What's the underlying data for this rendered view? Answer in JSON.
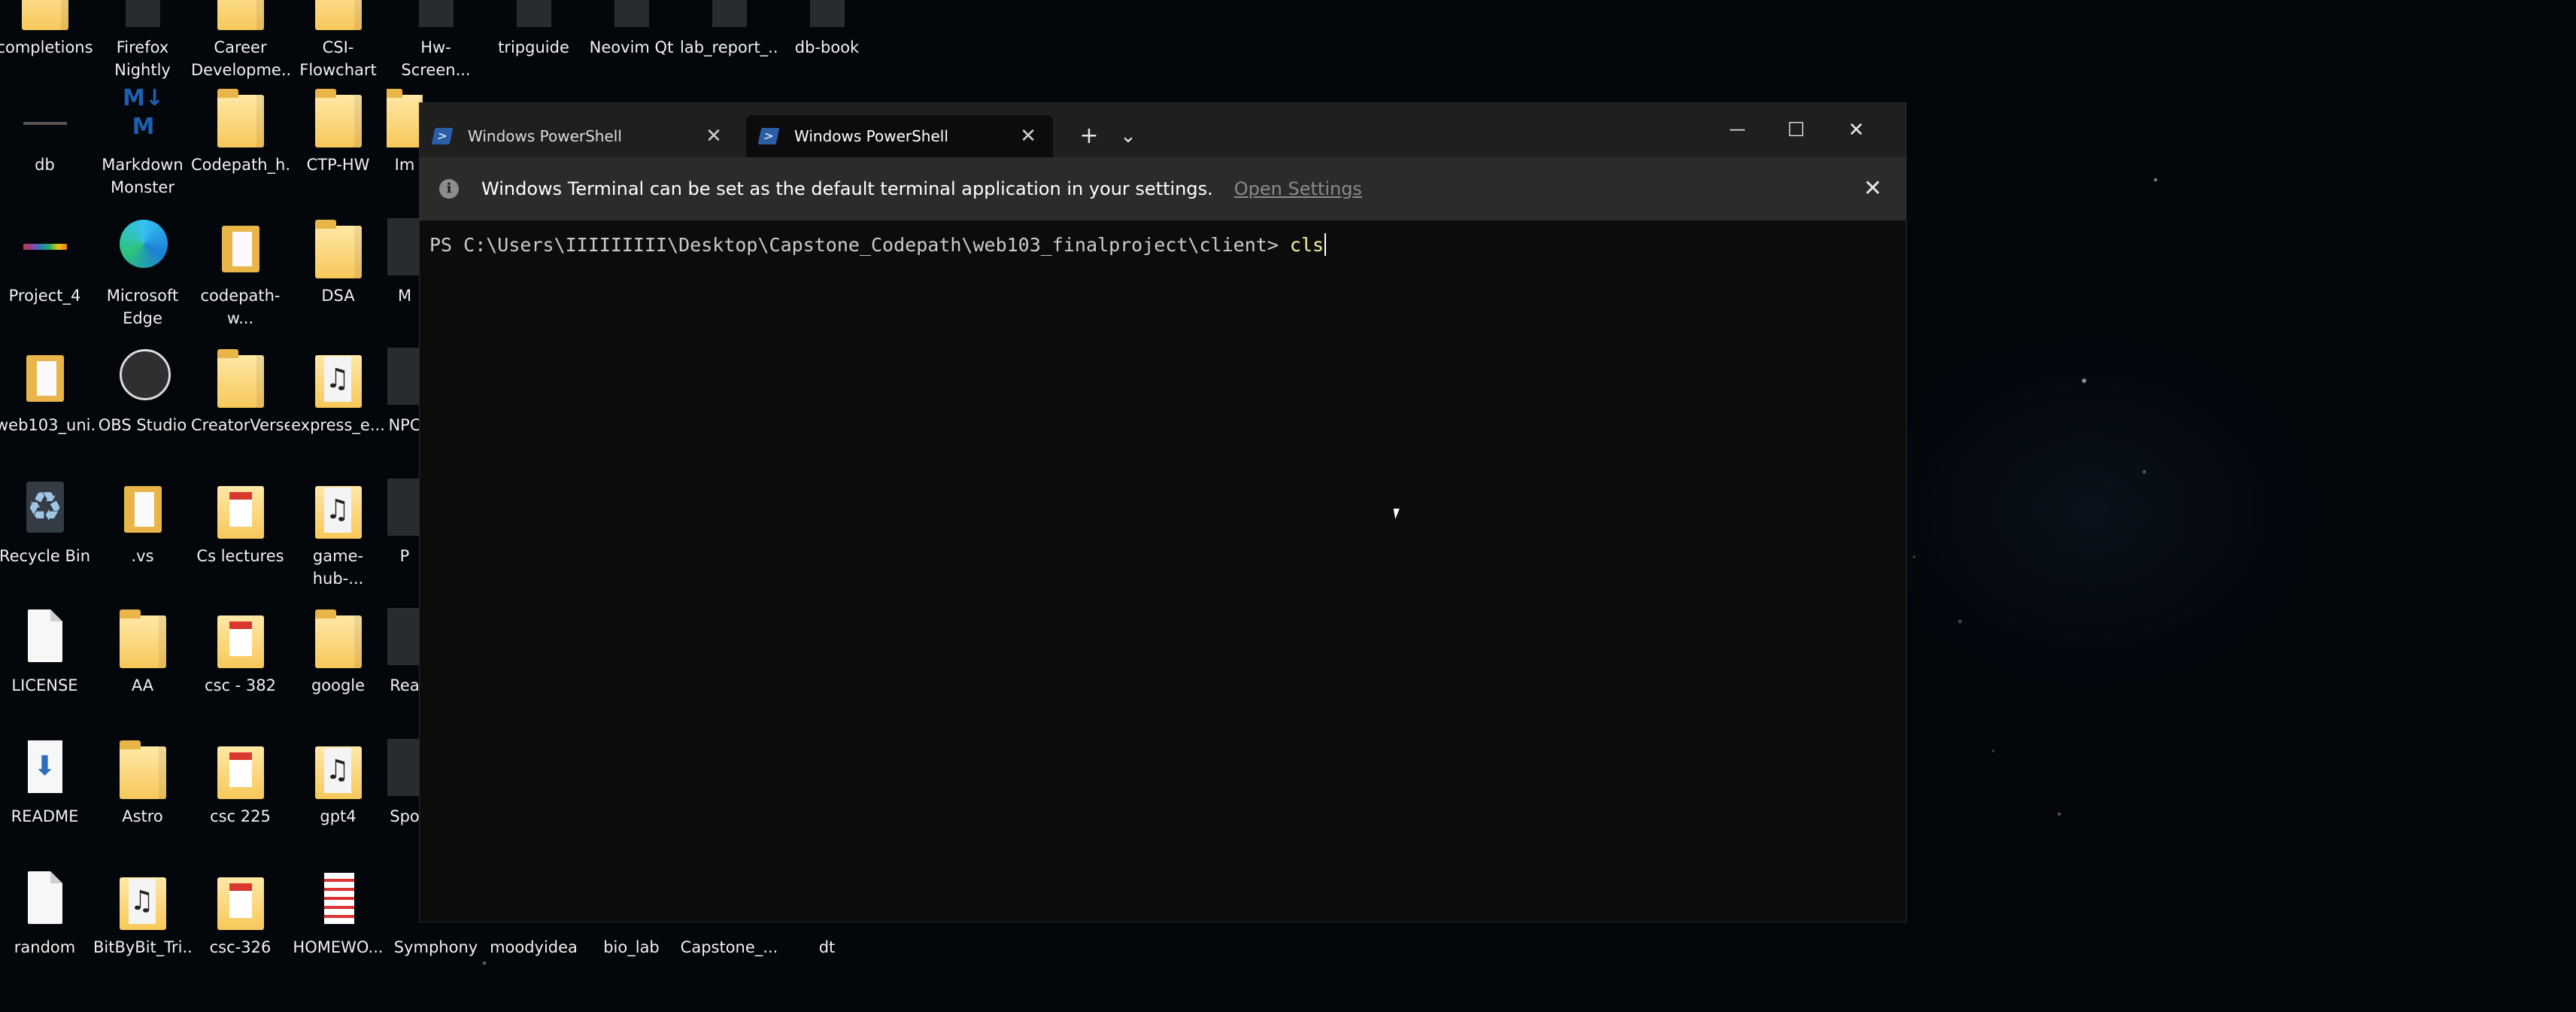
{
  "desktop": {
    "icons": [
      {
        "label": "completions",
        "glyph": "g-folder"
      },
      {
        "label": "Firefox\nNightly",
        "glyph": "g-tiny"
      },
      {
        "label": "Career\nDevelopme...",
        "glyph": "g-folder"
      },
      {
        "label": "CSI-Flowchart",
        "glyph": "g-folder"
      },
      {
        "label": "Hw-Screen...",
        "glyph": "g-tiny"
      },
      {
        "label": "tripguide",
        "glyph": "g-tiny"
      },
      {
        "label": "Neovim Qt",
        "glyph": "g-tiny"
      },
      {
        "label": "lab_report_...",
        "glyph": "g-tiny"
      },
      {
        "label": "db-book",
        "glyph": "g-tiny"
      },
      {
        "label": "db",
        "glyph": "g-db"
      },
      {
        "label": "Markdown\nMonster",
        "glyph": "g-mm"
      },
      {
        "label": "Codepath_h...",
        "glyph": "g-folder"
      },
      {
        "label": "CTP-HW",
        "glyph": "g-folder"
      },
      {
        "label": "Project_4",
        "glyph": "g-project"
      },
      {
        "label": "Microsoft\nEdge",
        "glyph": "g-edge"
      },
      {
        "label": "codepath-w...",
        "glyph": "g-folder-s"
      },
      {
        "label": "DSA",
        "glyph": "g-folder"
      },
      {
        "label": "web103_uni...",
        "glyph": "g-folder-s"
      },
      {
        "label": "OBS Studio",
        "glyph": "g-obs"
      },
      {
        "label": "CreatorVerse",
        "glyph": "g-folder"
      },
      {
        "label": "express_e...",
        "glyph": "g-music"
      },
      {
        "label": "Recycle Bin",
        "glyph": "g-recycle"
      },
      {
        "label": ".vs",
        "glyph": "g-folder-s"
      },
      {
        "label": "Cs lectures",
        "glyph": "g-doc"
      },
      {
        "label": "game-hub-...",
        "glyph": "g-music"
      },
      {
        "label": "LICENSE",
        "glyph": "g-file"
      },
      {
        "label": "AA",
        "glyph": "g-folder"
      },
      {
        "label": "csc - 382",
        "glyph": "g-doc"
      },
      {
        "label": "google",
        "glyph": "g-folder"
      },
      {
        "label": "README",
        "glyph": "g-readme"
      },
      {
        "label": "Astro",
        "glyph": "g-folder"
      },
      {
        "label": "csc 225",
        "glyph": "g-doc"
      },
      {
        "label": "gpt4",
        "glyph": "g-music"
      },
      {
        "label": "random",
        "glyph": "g-file"
      },
      {
        "label": "BitByBit_Tri...",
        "glyph": "g-music"
      },
      {
        "label": "csc-326",
        "glyph": "g-doc"
      },
      {
        "label": "HOMEWO...",
        "glyph": "g-hw"
      },
      {
        "label": "Symphony",
        "glyph": "g-tiny"
      },
      {
        "label": "moodyidea",
        "glyph": "g-tiny"
      },
      {
        "label": "bio_lab",
        "glyph": "g-tiny"
      },
      {
        "label": "Capstone_...",
        "glyph": "g-tiny"
      },
      {
        "label": "dt",
        "glyph": "g-tiny"
      }
    ],
    "partial_labels": [
      "Im",
      "M",
      "NPC",
      "P",
      "Rea",
      "Spo"
    ]
  },
  "terminal": {
    "tabs": [
      {
        "title": "Windows PowerShell",
        "active": false
      },
      {
        "title": "Windows PowerShell",
        "active": true
      }
    ],
    "new_tab_symbol": "+",
    "dropdown_symbol": "⌄",
    "window_buttons": {
      "minimize": "—",
      "maximize": "☐",
      "close": "✕"
    },
    "infobar": {
      "message": "Windows Terminal can be set as the default terminal application in your settings.",
      "link": "Open Settings",
      "close": "✕"
    },
    "prompt": "PS C:\\Users\\IIIIIIIII\\Desktop\\Capstone_Codepath\\web103_finalproject\\client> ",
    "command": "cls"
  },
  "colors": {
    "terminal_bg": "#0c0c0c",
    "titlebar_bg": "#1f1f1f",
    "infobar_bg": "#2b2b2b",
    "command_color": "#f9f1a5",
    "powershell_blue": "#2a5fa8"
  },
  "icons": {
    "tab_icon": "powershell-icon",
    "info_icon": "info-icon",
    "close_icon": "close-icon"
  }
}
